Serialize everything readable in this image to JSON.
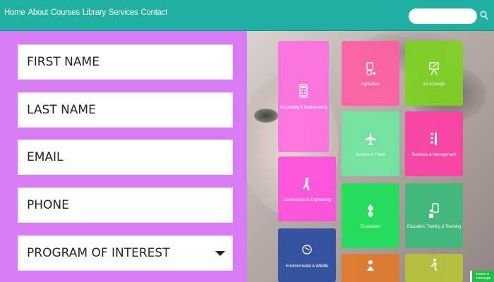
{
  "nav": {
    "links": [
      "Home",
      "About",
      "Courses",
      "Library",
      "Services",
      "Contact"
    ]
  },
  "search": {
    "placeholder": ""
  },
  "form": {
    "first_name": "FIRST NAME",
    "last_name": "LAST NAME",
    "email": "EMAIL",
    "phone": "PHONE",
    "program": "PROGRAM OF INTEREST"
  },
  "tiles": [
    {
      "label": "Accounting & Bookkeeping",
      "color": "#ff6fe0",
      "icon": "calculator-icon"
    },
    {
      "label": "Agriculture",
      "color": "#ff5fa3",
      "icon": "tractor-icon"
    },
    {
      "label": "Art & Design",
      "color": "#7ed321",
      "icon": "easel-icon"
    },
    {
      "label": "Aviation & Travel",
      "color": "#6ee7a0",
      "icon": "airplane-icon"
    },
    {
      "label": "Business & Management",
      "color": "#ff3fa4",
      "icon": "chart-icon"
    },
    {
      "label": "Construction & Engineering",
      "color": "#ff4fe0",
      "icon": "wrench-icon"
    },
    {
      "label": "Ecotourism",
      "color": "#1ee05a",
      "icon": "leaf-icon"
    },
    {
      "label": "Education, Training & Teaching",
      "color": "#3eb87a",
      "icon": "teacher-icon"
    },
    {
      "label": "Environmental & Wildlife",
      "color": "#2f4fa0",
      "icon": "globe-icon"
    },
    {
      "label": "",
      "color": "#e07a2e",
      "icon": "people-icon"
    },
    {
      "label": "",
      "color": "#b7c23a",
      "icon": "runner-icon"
    }
  ],
  "chat": {
    "label": "Leave a message"
  },
  "colors": {
    "header": "#20b0a2",
    "form_panel": "#d87cf4"
  }
}
